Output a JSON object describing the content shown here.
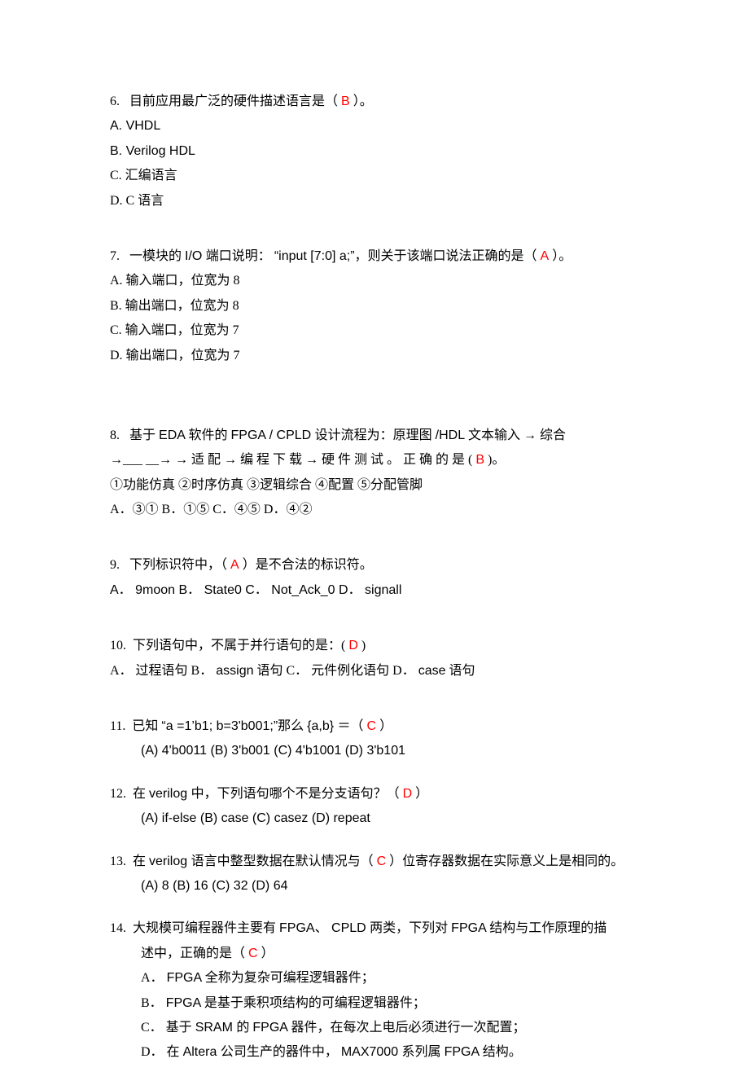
{
  "q6": {
    "num": "6.",
    "text_before": "目前应用最广泛的硬件描述语言是（ ",
    "answer": "B",
    "text_after": " ）。",
    "opts": [
      "A. VHDL",
      "B. Verilog HDL",
      "C. 汇编语言",
      "D. C 语言"
    ]
  },
  "q7": {
    "num": "7.",
    "text_before_latin": "一模块的 ",
    "latin1": "I/O ",
    "text_mid1": "端口说明：  ",
    "latin2": "“input [7:0] a;”",
    "text_mid2": "，则关于该端口说法正确的是（  ",
    "answer": "A",
    "text_after": "  ）。",
    "opts": [
      "A. 输入端口，位宽为 8",
      "B. 输出端口，位宽为 8",
      "C. 输入端口，位宽为 7",
      "D. 输出端口，位宽为 7"
    ]
  },
  "q8": {
    "num": "8.",
    "line1_a": "基于 ",
    "line1_latin1": "EDA ",
    "line1_b": "软件的 ",
    "line1_latin2": "FPGA / CPLD ",
    "line1_c": "设计流程为：原理图 ",
    "line1_latin3": "/HDL ",
    "line1_d": "文本输入 → 综合",
    "line2_before": "→___ __→ →",
    "line2_spaced": "适配→编程下载→硬件测试。正确的是",
    "line2_paren_open": "(   ",
    "answer": "B",
    "line2_paren_close": "   )。",
    "line3": "①功能仿真 ②时序仿真 ③逻辑综合 ④配置 ⑤分配管脚",
    "line4": "A．③①     B．①⑤     C．④⑤     D．④②"
  },
  "q9": {
    "num": "9.",
    "text_before": "下列标识符中，（    ",
    "answer": "A",
    "text_after": "    ）是不合法的标识符。",
    "opts": "A． 9moon    B． State0   C． Not_Ack_0   D． signall"
  },
  "q10": {
    "num": "10.",
    "text_before": "下列语句中，不属于并行语句的是：(      ",
    "answer": "D",
    "text_after": "     )",
    "opts_a": "A． 过程语句     B． ",
    "opts_latin1": "assign",
    "opts_b": " 语句   C． 元件例化语句     D．  ",
    "opts_latin2": "case",
    "opts_c": " 语句"
  },
  "q11": {
    "num": "11.",
    "text_before": "已知 ",
    "latin1": "“a =1’b1;   b=3'b001;”",
    "text_mid": "那么 ",
    "latin2": "{a,b} ",
    "text_eq": "＝（ ",
    "answer": "C",
    "text_after": " ）",
    "opts": "(A) 4'b0011     (B) 3'b001     (C) 4'b1001      (D) 3'b101"
  },
  "q12": {
    "num": "12.",
    "text_a": "在 ",
    "latin1": "verilog ",
    "text_b": "中，下列语句哪个不是分支语句？（ ",
    "answer": "D",
    "text_after": " ）",
    "opts": "(A) if-else     (B) case     (C) casez      (D) repeat"
  },
  "q13": {
    "num": "13.",
    "text_a": "在 ",
    "latin1": "verilog ",
    "text_b": "语言中整型数据在默认情况与（ ",
    "answer": "C",
    "text_c": " ）位寄存器数据在实际意义上是相同的。",
    "opts": "(A) 8                     (B) 16                 (C) 32                      (D) 64"
  },
  "q14": {
    "num": "14.",
    "text_a": "大规模可编程器件主要有 ",
    "latin1": "FPGA、 CPLD ",
    "text_b": "两类，下列对 ",
    "latin2": "FPGA ",
    "text_c": "结构与工作原理的描",
    "line2_before": "述中，正确的是（   ",
    "answer": "C",
    "line2_after": "   ）",
    "optA_a": "A．  ",
    "optA_latin": "FPGA ",
    "optA_b": "全称为复杂可编程逻辑器件；",
    "optB_a": "B．  ",
    "optB_latin": "FPGA ",
    "optB_b": "是基于乘积项结构的可编程逻辑器件；",
    "optC_a": "C． 基于 ",
    "optC_latin1": "SRAM ",
    "optC_b": "的 ",
    "optC_latin2": "FPGA ",
    "optC_c": "器件，在每次上电后必须进行一次配置；",
    "optD_a": "D． 在 ",
    "optD_latin1": "Altera ",
    "optD_b": "公司生产的器件中， ",
    "optD_latin2": "MAX7000 ",
    "optD_c": "系列属 ",
    "optD_latin3": "FPGA ",
    "optD_d": "结构。"
  }
}
